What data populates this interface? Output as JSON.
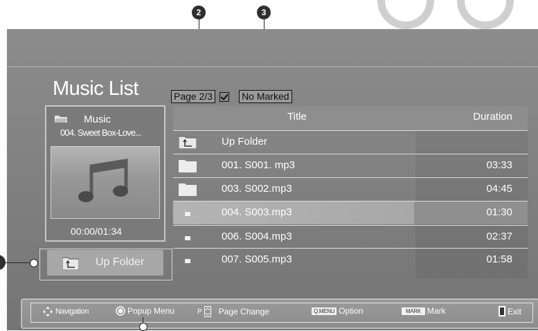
{
  "callouts": {
    "c2": "2",
    "c3": "3"
  },
  "header": {
    "title": "Music List"
  },
  "page_info": {
    "page": "Page 2/3",
    "marked": "No Marked",
    "check_icon": "checkbox-checked-icon"
  },
  "preview": {
    "folder": "Music",
    "song": "004. Sweet Box-Love...",
    "time": "00:00/01:34",
    "art_icon": "music-note-icon"
  },
  "up_button": {
    "label": "Up Folder"
  },
  "list": {
    "headers": {
      "title": "Title",
      "duration": "Duration"
    },
    "rows": [
      {
        "name": "Up Folder",
        "duration": "",
        "type": "up-folder"
      },
      {
        "name": "001. S001. mp3",
        "duration": "03:33",
        "type": "folder"
      },
      {
        "name": "003. S002.mp3",
        "duration": "04:45",
        "type": "folder"
      },
      {
        "name": "004. S003.mp3",
        "duration": "01:30",
        "type": "file",
        "selected": true
      },
      {
        "name": "006. S004.mp3",
        "duration": "02:37",
        "type": "file"
      },
      {
        "name": "007. S005.mp3",
        "duration": "01:58",
        "type": "file"
      }
    ]
  },
  "footer": {
    "navigation": "Navigation",
    "popup": "Popup Menu",
    "p_key": "P",
    "page_change": "Page Change",
    "qmenu_key": "Q.MENU",
    "option": "Option",
    "mark_key": "MARK",
    "mark": "Mark",
    "exit": "Exit"
  }
}
